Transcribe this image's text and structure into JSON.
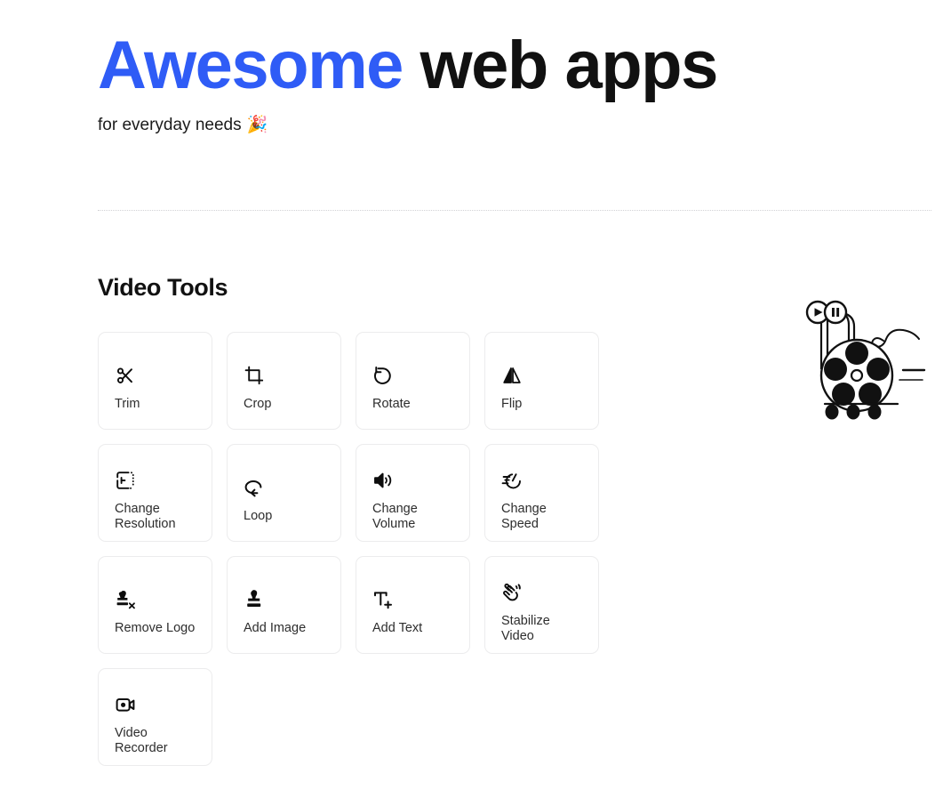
{
  "header": {
    "title_accent": "Awesome",
    "title_rest": " web apps",
    "subtitle": "for everyday needs",
    "subtitle_emoji": "🎉",
    "accent_color": "#2f5cf6",
    "title_color": "#111111"
  },
  "section": {
    "title": "Video Tools",
    "tools": [
      {
        "label": "Trim",
        "icon": "scissors-icon"
      },
      {
        "label": "Crop",
        "icon": "crop-icon"
      },
      {
        "label": "Rotate",
        "icon": "rotate-ccw-icon"
      },
      {
        "label": "Flip",
        "icon": "flip-icon"
      },
      {
        "label": "Change Resolution",
        "icon": "resolution-icon"
      },
      {
        "label": "Loop",
        "icon": "loop-icon"
      },
      {
        "label": "Change Volume",
        "icon": "volume-icon"
      },
      {
        "label": "Change Speed",
        "icon": "speedometer-icon"
      },
      {
        "label": "Remove Logo",
        "icon": "stamp-remove-icon"
      },
      {
        "label": "Add Image",
        "icon": "stamp-icon"
      },
      {
        "label": "Add Text",
        "icon": "text-add-icon"
      },
      {
        "label": "Stabilize Video",
        "icon": "waving-hand-icon"
      },
      {
        "label": "Video Recorder",
        "icon": "camcorder-icon"
      }
    ]
  },
  "illustration": {
    "name": "film-reel-illustration",
    "parts": [
      "play-button",
      "pause-button",
      "film-strip",
      "reel",
      "wheels",
      "equals-lines"
    ]
  }
}
